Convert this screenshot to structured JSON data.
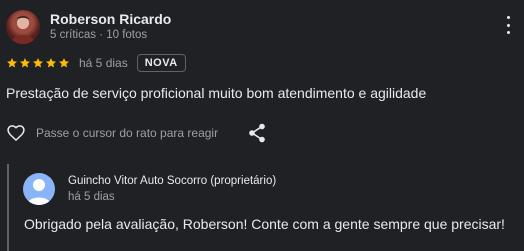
{
  "review": {
    "author": {
      "name": "Roberson Ricardo",
      "meta": "5 críticas · 10 fotos"
    },
    "rating": 5,
    "date": "há 5 dias",
    "badge": "NOVA",
    "text": "Prestação de serviço proficional muito bom atendimento e agilidade",
    "react_label": "Passe o cursor do rato para reagir"
  },
  "reply": {
    "owner_name": "Guincho Vitor Auto Socorro (proprietário)",
    "date": "há 5 dias",
    "text": "Obrigado pela avaliação, Roberson! Conte com a gente sempre que precisar!"
  },
  "colors": {
    "background": "#202124",
    "star": "#fbbc04",
    "owner_avatar": "#8ab4f8",
    "muted_text": "#9aa0a6"
  },
  "icons": [
    "avatar",
    "more-vert-icon",
    "star-icon",
    "heart-icon",
    "share-icon",
    "person-icon"
  ]
}
